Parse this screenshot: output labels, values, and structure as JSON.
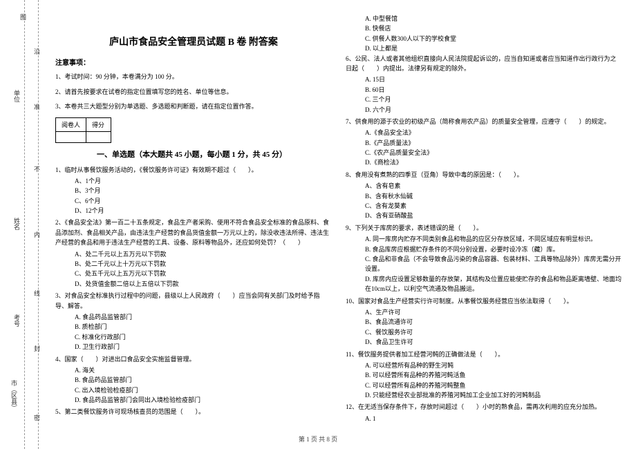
{
  "binding": {
    "labels": [
      "图",
      "沿",
      "单位",
      "准",
      "不",
      "姓名",
      "内",
      "线",
      "考号",
      "封",
      "市（区县）",
      "密"
    ]
  },
  "title": "庐山市食品安全管理员试题 B 卷  附答案",
  "notice_header": "注意事项：",
  "notices": [
    "1、考试时间：90 分钟，本卷满分为 100 分。",
    "2、请首先按要求在试卷的指定位置填写您的姓名、单位等信息。",
    "3、本卷共三大题型分别为单选题、多选题和判断题，请在指定位置作答。"
  ],
  "score_table": {
    "h1": "阅卷人",
    "h2": "得分"
  },
  "section1_header": "一、单选题（本大题共 45 小题，每小题 1 分，共 45 分）",
  "left_questions": [
    {
      "num": "1",
      "text": "临时从事餐饮服务活动的，《餐饮服务许可证》有效期不超过（　　）。",
      "opts": [
        "A、1个月",
        "B、3个月",
        "C、6个月",
        "D、12个月"
      ]
    },
    {
      "num": "2",
      "text": "《食品安全法》第一百二十五条规定，食品生产者采购、使用不符合食品安全标准的食品原料、食品添加剂、食品相关产品，由违法生产经营的食品货值金额一万元以上的，除没收违法所得、违法生产经营的食品和用于违法生产经营的工具、设备、原料等物品外，还应如何处罚？（　　）",
      "opts": [
        "A、处二千元以上五万元以下罚款",
        "B、处二千元以上十万元以下罚款",
        "C、处五千元以上五万元以下罚款",
        "D、处货值金额二倍以上五倍以下罚款"
      ]
    },
    {
      "num": "3",
      "text": "对食品安全标准执行过程中的问题，县级以上人民政府（　　）应当会同有关部门及时给予指导、解答。",
      "opts": [
        "A. 食品药品监管部门",
        "B. 质检部门",
        "C. 标准化行政部门",
        "D. 卫生行政部门"
      ]
    },
    {
      "num": "4",
      "text": "国家（　　）对进出口食品安全实施监督管理。",
      "opts": [
        "A. 海关",
        "B. 食品药品监管部门",
        "C. 出入境检验检疫部门",
        "D. 食品药品监管部门会同出入境检验检疫部门"
      ]
    },
    {
      "num": "5",
      "text": "第二类餐饮服务许可现场核查员的范围是（　　）。",
      "opts": []
    }
  ],
  "right_questions": [
    {
      "num": "",
      "text": "",
      "opts": [
        "A. 中型餐馆",
        "B. 快餐店",
        "C. 供餐人数300人以下的学校食堂",
        "D. 以上都是"
      ]
    },
    {
      "num": "6",
      "text": "公民、法人或者其他组织直接向人民法院提起诉讼的，应当自知道或者应当知道作出行政行为之日起（　　）内提出。法律另有规定的除外。",
      "opts": [
        "A. 15日",
        "B. 60日",
        "C. 三个月",
        "D. 六个月"
      ]
    },
    {
      "num": "7",
      "text": "供食用的源于农业的初级产品（简称食用农产品）的质量安全管理，应遵守（　　）的规定。",
      "opts": [
        "A.《食品安全法》",
        "B.《产品质量法》",
        "C.《农产品质量安全法》",
        "D.《商检法》"
      ]
    },
    {
      "num": "8",
      "text": "食用没有煮熟的四季豆（豆角）导致中毒的原因是：（　　）。",
      "opts": [
        "A、含有皂素",
        "B、含有秋水仙碱",
        "C、含有龙葵素",
        "D、含有亚硝酸盐"
      ]
    },
    {
      "num": "9",
      "text": "下列关于库房的要求，表述错误的是（　　）。",
      "opts": [
        "A. 同一库房内贮存不同类别食品和物品的应区分存放区域，不同区域应有明显标识。",
        "B. 食品库房应根据贮存条件的不同分别设置，必要时设冷冻（藏）库。",
        "C. 食品和非食品（不会导致食品污染的食品容器、包装材料、工具等物品除外）库房无需分开设置。",
        "D. 库房内应设置足够数量的存放架，其结构及位置应能使贮存的食品和物品距离墙壁、地面均在10cm以上，以利空气流通及物品搬运。"
      ]
    },
    {
      "num": "10",
      "text": "国家对食品生产经营实行许可制度。从事餐饮服务经营应当依法取得（　　）。",
      "opts": [
        "A、生产许可",
        "B、食品流通许可",
        "C、餐饮服务许可",
        "D、食品卫生许可"
      ]
    },
    {
      "num": "11",
      "text": "餐饮服务提供者加工经营河鲀的正确做法是（　　）。",
      "opts": [
        "A. 可以经营所有品种的野生河鲀",
        "B. 可以经营所有品种的养殖河鲀活鱼",
        "C. 可以经营所有品种的养殖河鲀整鱼",
        "D. 只能经营经农业部批准的养殖河鲀加工企业加工好的河鲀制品"
      ]
    },
    {
      "num": "12",
      "text": "在无适当保存条件下，存放时间超过（　　）小时的熟食品，需再次利用的应充分加热。",
      "opts": [
        "A. 1"
      ]
    }
  ],
  "footer": "第 1 页 共 8 页"
}
